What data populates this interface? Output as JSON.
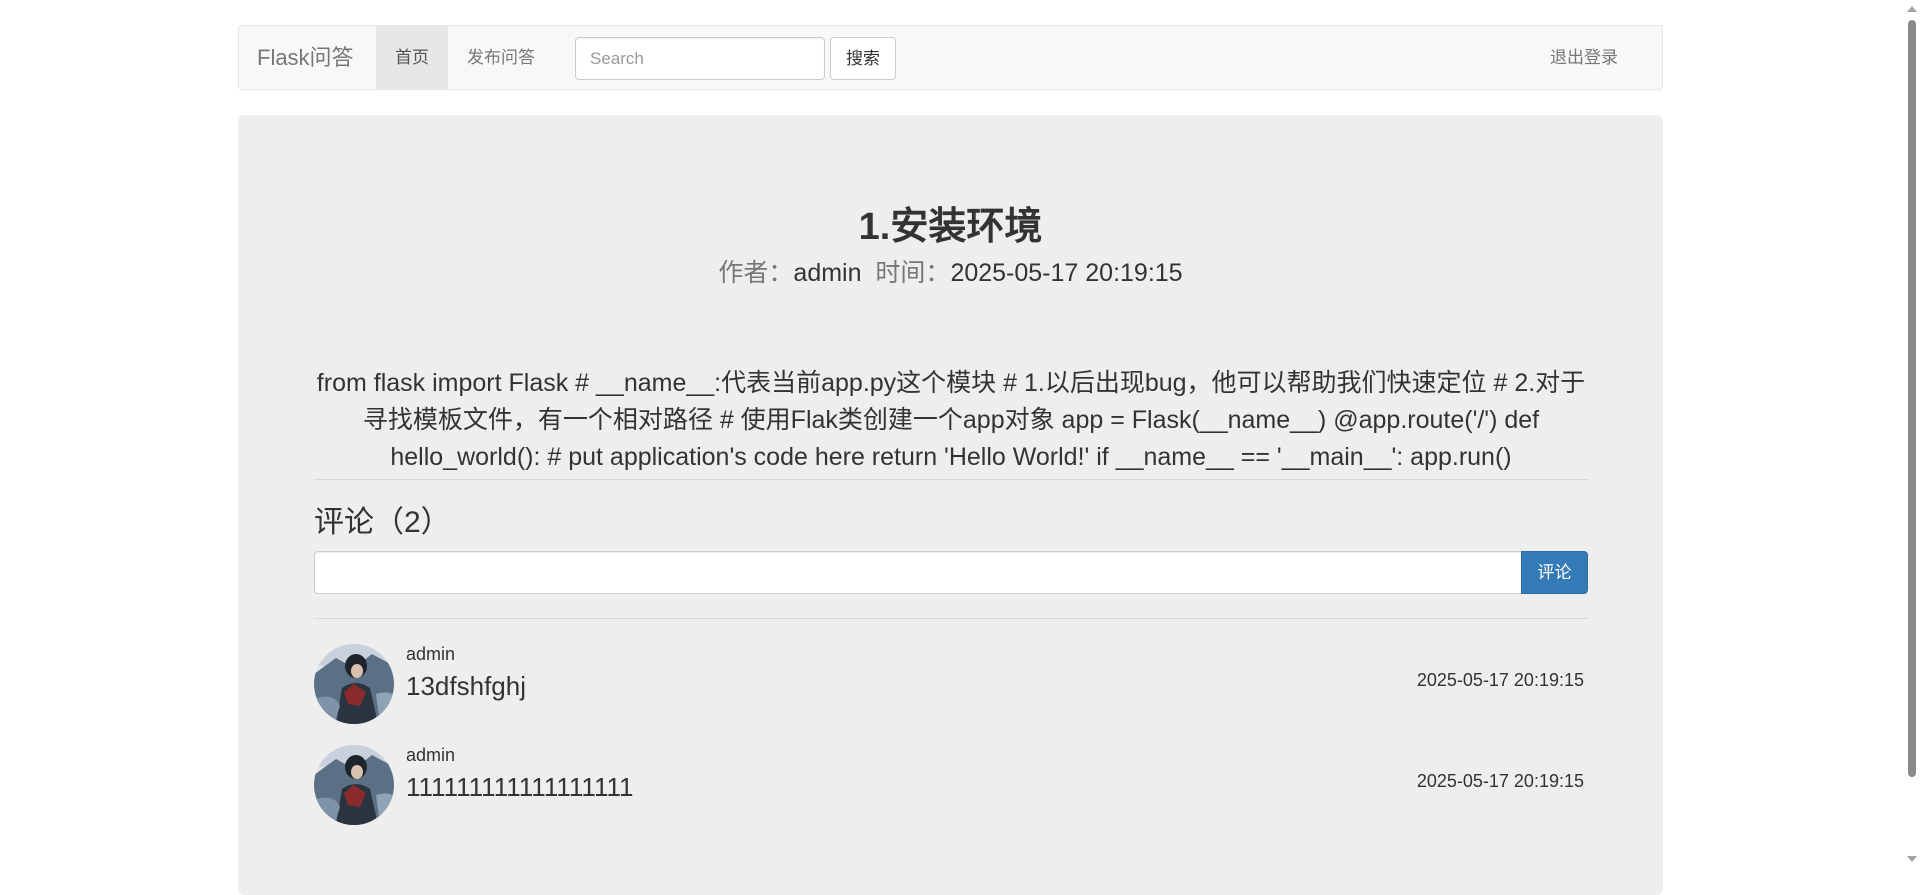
{
  "navbar": {
    "brand": "Flask问答",
    "home_label": "首页",
    "publish_label": "发布问答",
    "search_placeholder": "Search",
    "search_button": "搜索",
    "logout_label": "退出登录"
  },
  "question": {
    "title": "1.安装环境",
    "author_label": "作者：",
    "author": "admin",
    "time_label": "时间：",
    "time": "2025-05-17 20:19:15",
    "content": "from flask import Flask # __name__:代表当前app.py这个模块 # 1.以后出现bug，他可以帮助我们快速定位 # 2.对于寻找模板文件，有一个相对路径 # 使用Flak类创建一个app对象 app = Flask(__name__) @app.route('/') def hello_world(): # put application's code here return 'Hello World!' if __name__ == '__main__': app.run()"
  },
  "comments": {
    "heading": "评论（2）",
    "input_value": "",
    "submit_label": "评论",
    "items": [
      {
        "user": "admin",
        "text": "13dfshfghj",
        "time": "2025-05-17 20:19:15"
      },
      {
        "user": "admin",
        "text": "111111111111111111",
        "time": "2025-05-17 20:19:15"
      }
    ]
  },
  "colors": {
    "navbar_bg": "#f8f8f8",
    "panel_bg": "#eeeeee",
    "primary": "#337ab7",
    "muted_text": "#777777"
  }
}
